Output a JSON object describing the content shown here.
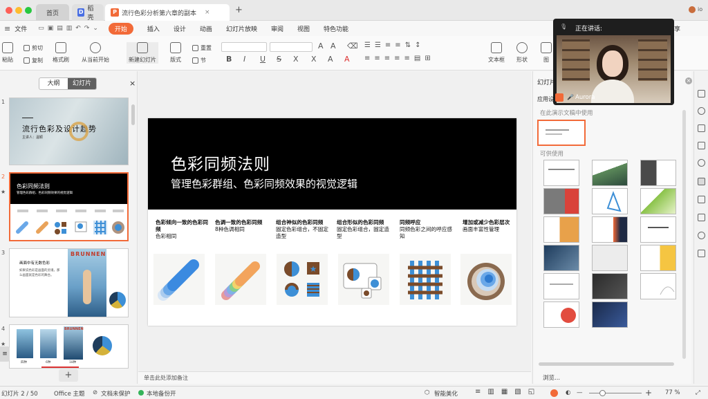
{
  "window": {
    "tabs": [
      {
        "label": "首页"
      },
      {
        "label": "稻壳"
      },
      {
        "label": "流行色彩分析第六章的副本"
      }
    ],
    "add_tab": "+"
  },
  "menu": {
    "file": "文件",
    "items": [
      "开始",
      "插入",
      "设计",
      "动画",
      "幻灯片放映",
      "审阅",
      "视图",
      "特色功能"
    ],
    "share": "享"
  },
  "ribbon": {
    "paste": "粘贴",
    "cut": "剪切",
    "copy": "复制",
    "format_painter": "格式刷",
    "play_from_current": "从当前开始",
    "new_slide": "新建幻灯片",
    "layout": "版式",
    "section": "节",
    "reset": "重置",
    "textbox": "文本框",
    "shape": "形状",
    "picture": "图"
  },
  "left_panel": {
    "tab_outline": "大纲",
    "tab_slides": "幻灯片",
    "close": "×",
    "slides": [
      {
        "num": "1",
        "title": "流行色彩及设计趋势",
        "subtitle": "主讲人：温颖"
      },
      {
        "num": "2",
        "title": "色彩同频法则",
        "subtitle": "管理色彩群组、色彩同频效果的视觉逻辑"
      },
      {
        "num": "3",
        "title": "画面中有无数色彩",
        "body": "如果说色彩是画面的灵魂，那么画面就是色彩的舞台。",
        "poster": "BRUNNEN"
      },
      {
        "num": "4",
        "labels": [
          "四种",
          "6种",
          "18种"
        ],
        "poster": "BRUNNEN"
      }
    ],
    "add": "+"
  },
  "slide": {
    "title": "色彩同频法则",
    "subtitle": "管理色彩群组、色彩同频效果的视觉逻辑",
    "columns": [
      {
        "heading": "色彩倾向一致的色彩同频",
        "text": "色彩相同"
      },
      {
        "heading": "色调一致的色彩同频",
        "text": "8种色调相同"
      },
      {
        "heading": "组合神似的色彩同频",
        "text": "固定色彩组合，不固定造型"
      },
      {
        "heading": "组合形似的色彩同频",
        "text": "固定色彩组合，固定造型"
      },
      {
        "heading": "同频呼应",
        "text": "同频色彩之间的呼应感知"
      },
      {
        "heading": "增加或减少色彩层次",
        "text": "画面丰富性管理"
      }
    ]
  },
  "notes_placeholder": "单击此处添加备注",
  "right_panel": {
    "title": "幻灯片",
    "apply_label": "应用设",
    "used_in_doc": "在此演示文稿中使用",
    "available": "可供使用",
    "browse": "浏览..."
  },
  "video": {
    "speaking_label": "正在讲话:",
    "name": "Aurora"
  },
  "statusbar": {
    "slide_pos": "幻灯片 2 / 50",
    "theme": "Office 主题",
    "protect": "文档未保护",
    "backup": "本地备份开",
    "smart": "智能美化",
    "zoom": "77 %",
    "minus": "—",
    "plus": "+"
  },
  "colors": {
    "accent": "#f26a38",
    "blue": "#3d8fd6",
    "brown": "#7a4b2a",
    "dark": "#000000"
  }
}
